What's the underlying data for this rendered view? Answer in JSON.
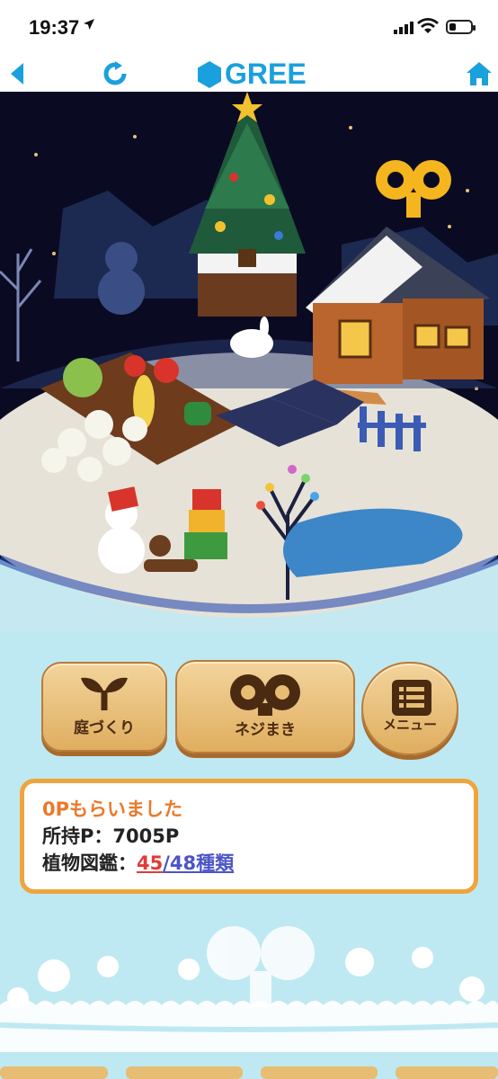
{
  "status_bar": {
    "time": "19:37",
    "battery_level": 0.3
  },
  "nav": {
    "brand": "GREE"
  },
  "buttons": {
    "garden_label": "庭づくり",
    "wind_label": "ネジまき",
    "menu_label": "メニュー"
  },
  "info": {
    "message": "0Pもらいました",
    "points_line": "所持P：7005P",
    "plants_prefix": "植物図鑑：",
    "plants_count": "45",
    "plants_total": "/48種類"
  },
  "colors": {
    "brand_blue": "#1aa0dc",
    "panel_border": "#f0a43b",
    "message_orange": "#ea7a2b",
    "count_red": "#e13a3a",
    "link_blue": "#4b54c9"
  },
  "icons": [
    "location-arrow-icon",
    "signal-icon",
    "wifi-icon",
    "battery-icon",
    "back-arrow-icon",
    "reload-icon",
    "gree-hexagon-icon",
    "home-icon",
    "sprout-icon",
    "wind-key-icon",
    "menu-list-icon"
  ]
}
